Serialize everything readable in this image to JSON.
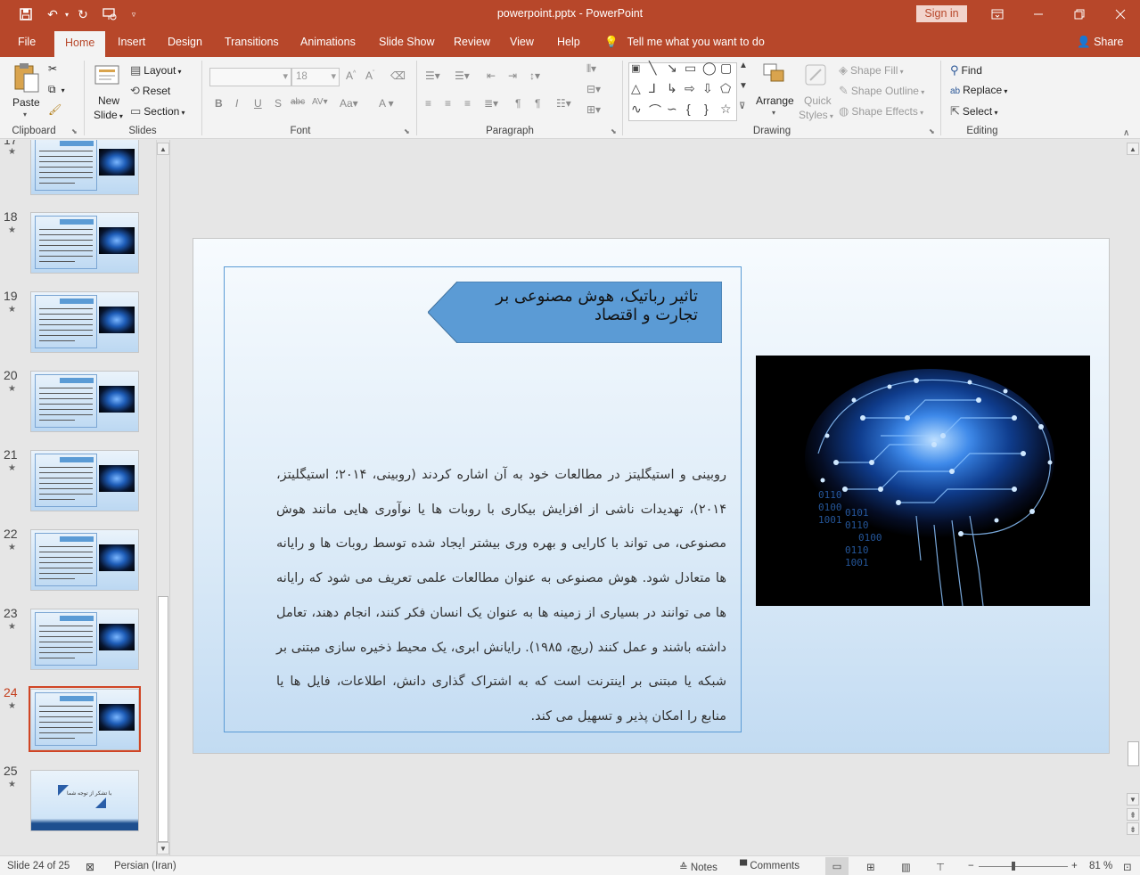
{
  "app": {
    "doc_title": "powerpoint.pptx  -  PowerPoint",
    "sign_in": "Sign in"
  },
  "tabs": {
    "file": "File",
    "home": "Home",
    "insert": "Insert",
    "design": "Design",
    "transitions": "Transitions",
    "animations": "Animations",
    "slide_show": "Slide Show",
    "review": "Review",
    "view": "View",
    "help": "Help",
    "tell_me": "Tell me what you want to do",
    "share": "Share"
  },
  "ribbon": {
    "clipboard": {
      "paste": "Paste",
      "label": "Clipboard"
    },
    "slides": {
      "new_slide_1": "New",
      "new_slide_2": "Slide",
      "layout": "Layout",
      "reset": "Reset",
      "section": "Section",
      "label": "Slides"
    },
    "font": {
      "size": "18",
      "label": "Font"
    },
    "paragraph": {
      "label": "Paragraph"
    },
    "drawing": {
      "arrange": "Arrange",
      "quick_styles_1": "Quick",
      "quick_styles_2": "Styles",
      "shape_fill": "Shape Fill",
      "shape_outline": "Shape Outline",
      "shape_effects": "Shape Effects",
      "label": "Drawing"
    },
    "editing": {
      "find": "Find",
      "replace": "Replace",
      "select": "Select",
      "label": "Editing"
    }
  },
  "thumbnails": {
    "numbers": [
      "17",
      "18",
      "19",
      "20",
      "21",
      "22",
      "23",
      "24",
      "25"
    ],
    "selected": "24",
    "last_slide_text": "با تشکر از توجه شما"
  },
  "slide": {
    "title": "تاثیر رباتیک، هوش مصنوعی بر تجارت و اقتصاد",
    "body": "روبینی و استیگلیتز در مطالعات خود به آن اشاره کردند (روبینی، ۲۰۱۴؛ استیگلیتز، ۲۰۱۴)، تهدیدات ناشی از افزایش بیکاری با روبات ها یا نوآوری هایی مانند هوش مصنوعی، می تواند با کارایی و بهره وری بیشتر ایجاد شده توسط روبات ها و رایانه ها متعادل شود. هوش مصنوعی به عنوان مطالعات علمی تعریف می شود که رایانه ها می توانند در بسیاری از زمینه ها به عنوان یک انسان فکر کنند، انجام دهند، تعامل داشته باشند و عمل کنند (ریچ، ۱۹۸۵). رایانش ابری، یک محیط ذخیره سازی مبتنی بر شبکه یا مبتنی بر اینترنت است که به اشتراک گذاری دانش، اطلاعات، فایل ها یا منابع را امکان پذیر و تسهیل می کند."
  },
  "status": {
    "slide_info": "Slide 24 of 25",
    "language": "Persian (Iran)",
    "notes": "Notes",
    "comments": "Comments",
    "zoom": "81 %"
  },
  "colors": {
    "accent": "#b7472a",
    "title_shape": "#5b9bd5",
    "selected_thumb_border": "#d04525"
  }
}
